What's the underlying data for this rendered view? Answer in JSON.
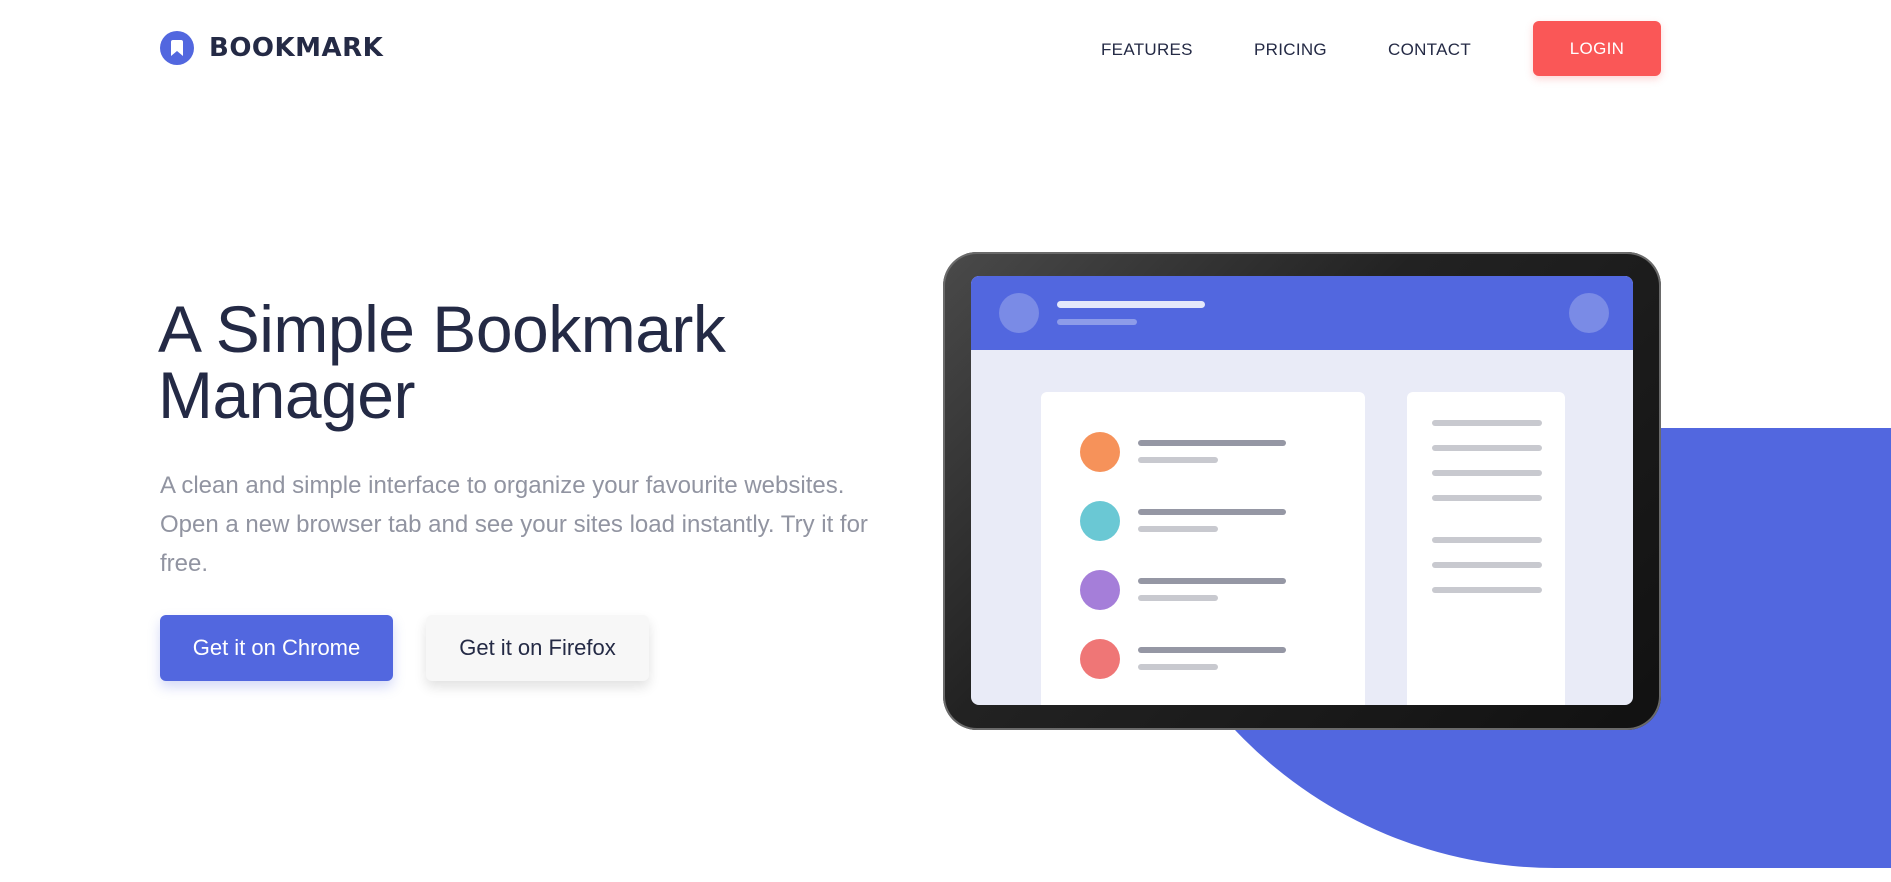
{
  "header": {
    "logo_text": "BOOKMARK",
    "nav": [
      {
        "label": "FEATURES"
      },
      {
        "label": "PRICING"
      },
      {
        "label": "CONTACT"
      }
    ],
    "login_label": "LOGIN"
  },
  "hero": {
    "title_line1": "A Simple Bookmark",
    "title_line2": "Manager",
    "description": "A clean and simple interface to organize your favourite websites. Open a new browser tab and see your sites load instantly. Try it for free.",
    "cta_chrome": "Get it on Chrome",
    "cta_firefox": "Get it on Firefox"
  },
  "colors": {
    "brand_blue": "#5267df",
    "brand_red": "#fa5757",
    "text_dark": "#242a45",
    "text_gray": "#9194a1"
  },
  "illustration": {
    "icon": "tablet-mockup",
    "row_dot_colors": [
      "#f6925a",
      "#6ac8d4",
      "#a57ed9",
      "#ef7676"
    ]
  }
}
